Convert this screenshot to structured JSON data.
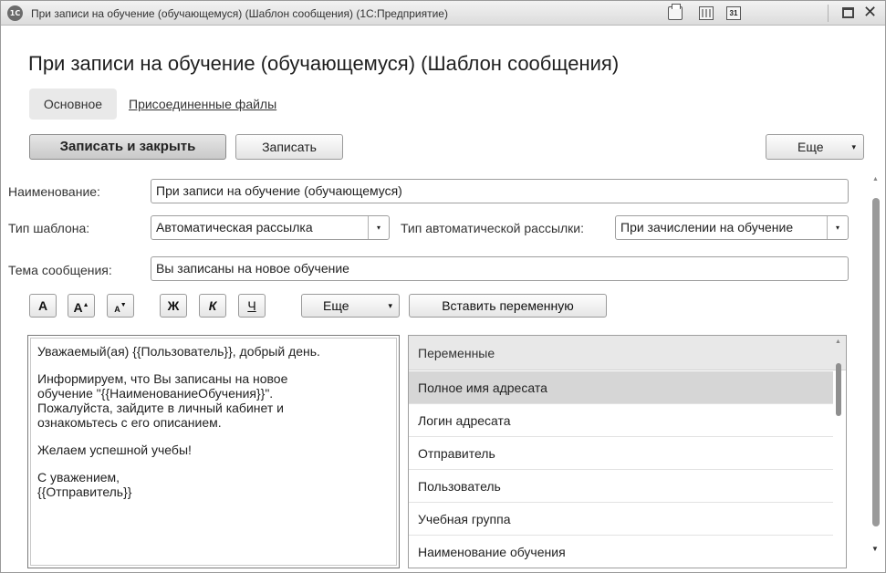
{
  "window": {
    "title": "При записи на обучение (обучающемуся) (Шаблон сообщения)  (1С:Предприятие)",
    "logo": "1С",
    "icons": [
      "printer-icon",
      "calculator-icon",
      "calendar-icon",
      "maximize-icon",
      "close-icon"
    ],
    "calendar_glyph": "31",
    "close_glyph": "✕"
  },
  "form": {
    "title": "При записи на обучение (обучающемуся) (Шаблон сообщения)",
    "tabs": [
      {
        "label": "Основное",
        "active": true
      },
      {
        "label": "Присоединенные файлы",
        "active": false
      }
    ]
  },
  "toolbar": {
    "save_close_label": "Записать и закрыть",
    "save_label": "Записать",
    "more_label": "Еще",
    "arrow": "▾"
  },
  "fields": {
    "name_label": "Наименование:",
    "name_value": "При записи на обучение (обучающемуся)",
    "template_type_label": "Тип шаблона:",
    "template_type_value": "Автоматическая рассылка",
    "auto_mailing_type_label": "Тип автоматической рассылки:",
    "auto_mailing_type_value": "При зачислении на обучение",
    "subject_label": "Тема сообщения:",
    "subject_value": "Вы записаны на новое обучение"
  },
  "format_bar": {
    "font_default": "A",
    "font_bigger": "A",
    "font_smaller": "A",
    "bold": "Ж",
    "italic": "К",
    "underline": "Ч",
    "more_label": "Еще",
    "insert_variable_label": "Вставить переменную"
  },
  "message_body": {
    "paragraphs": [
      "Уважаемый(ая) {{Пользователь}}, добрый день.",
      "Информируем, что Вы записаны на новое\nобучение \"{{НаименованиеОбучения}}\".\nПожалуйста, зайдите в личный кабинет и\nознакомьтесь с его описанием.",
      "Желаем успешной учебы!",
      "С уважением,\n{{Отправитель}}"
    ]
  },
  "variables": {
    "header": "Переменные",
    "items": [
      {
        "label": "Полное имя адресата",
        "selected": true
      },
      {
        "label": "Логин адресата",
        "selected": false
      },
      {
        "label": "Отправитель",
        "selected": false
      },
      {
        "label": "Пользователь",
        "selected": false
      },
      {
        "label": "Учебная группа",
        "selected": false
      },
      {
        "label": "Наименование обучения",
        "selected": false
      }
    ]
  }
}
